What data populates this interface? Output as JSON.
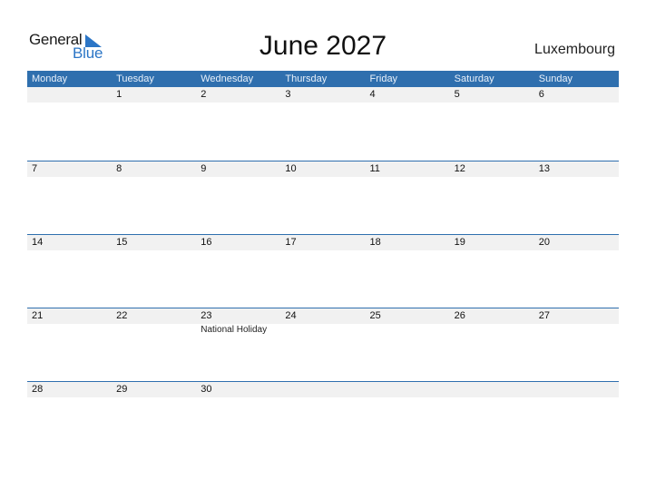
{
  "logo": {
    "line1": "General",
    "line2": "Blue",
    "accent": "#2b75c6"
  },
  "title": "June 2027",
  "country": "Luxembourg",
  "colors": {
    "header_bg": "#2f6fae",
    "date_band": "#f1f1f1"
  },
  "weekdays": [
    "Monday",
    "Tuesday",
    "Wednesday",
    "Thursday",
    "Friday",
    "Saturday",
    "Sunday"
  ],
  "weeks": [
    {
      "days": [
        "",
        "1",
        "2",
        "3",
        "4",
        "5",
        "6"
      ],
      "events": [
        "",
        "",
        "",
        "",
        "",
        "",
        ""
      ]
    },
    {
      "days": [
        "7",
        "8",
        "9",
        "10",
        "11",
        "12",
        "13"
      ],
      "events": [
        "",
        "",
        "",
        "",
        "",
        "",
        ""
      ]
    },
    {
      "days": [
        "14",
        "15",
        "16",
        "17",
        "18",
        "19",
        "20"
      ],
      "events": [
        "",
        "",
        "",
        "",
        "",
        "",
        ""
      ]
    },
    {
      "days": [
        "21",
        "22",
        "23",
        "24",
        "25",
        "26",
        "27"
      ],
      "events": [
        "",
        "",
        "National Holiday",
        "",
        "",
        "",
        ""
      ]
    },
    {
      "days": [
        "28",
        "29",
        "30",
        "",
        "",
        "",
        ""
      ],
      "events": [
        "",
        "",
        "",
        "",
        "",
        "",
        ""
      ]
    }
  ]
}
